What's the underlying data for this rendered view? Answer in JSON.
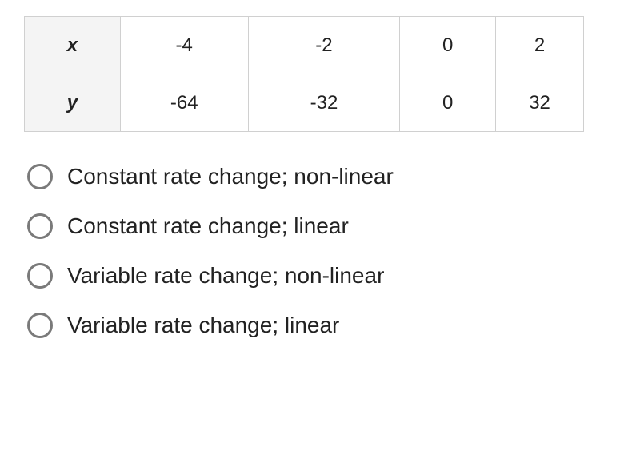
{
  "table": {
    "rows": [
      {
        "header": "x",
        "cells": [
          "-4",
          "-2",
          "0",
          "2"
        ]
      },
      {
        "header": "y",
        "cells": [
          "-64",
          "-32",
          "0",
          "32"
        ]
      }
    ]
  },
  "options": [
    {
      "label": "Constant rate change; non-linear"
    },
    {
      "label": "Constant rate change; linear"
    },
    {
      "label": "Variable rate change; non-linear"
    },
    {
      "label": "Variable rate change; linear"
    }
  ]
}
